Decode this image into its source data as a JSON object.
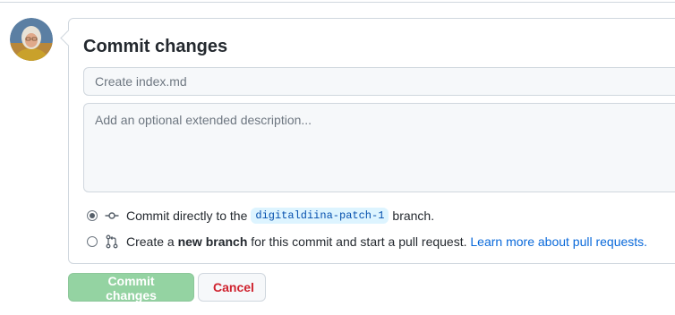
{
  "form": {
    "title": "Commit changes",
    "summary_placeholder": "Create index.md",
    "description_placeholder": "Add an optional extended description...",
    "option_direct": {
      "prefix": "Commit directly to the",
      "branch": "digitaldiina-patch-1",
      "suffix": "branch.",
      "selected": true,
      "icon": "git-commit-icon"
    },
    "option_new_branch": {
      "prefix": "Create a",
      "bold": "new branch",
      "middle": "for this commit and start a pull request.",
      "link": "Learn more about pull requests.",
      "selected": false,
      "icon": "git-pull-request-icon"
    }
  },
  "buttons": {
    "commit_label": "Commit changes",
    "cancel_label": "Cancel"
  },
  "colors": {
    "commit_button_bg": "#94d3a2",
    "cancel_text": "#cf222e",
    "link": "#0969da",
    "branch_tag_bg": "#ddf4ff"
  }
}
